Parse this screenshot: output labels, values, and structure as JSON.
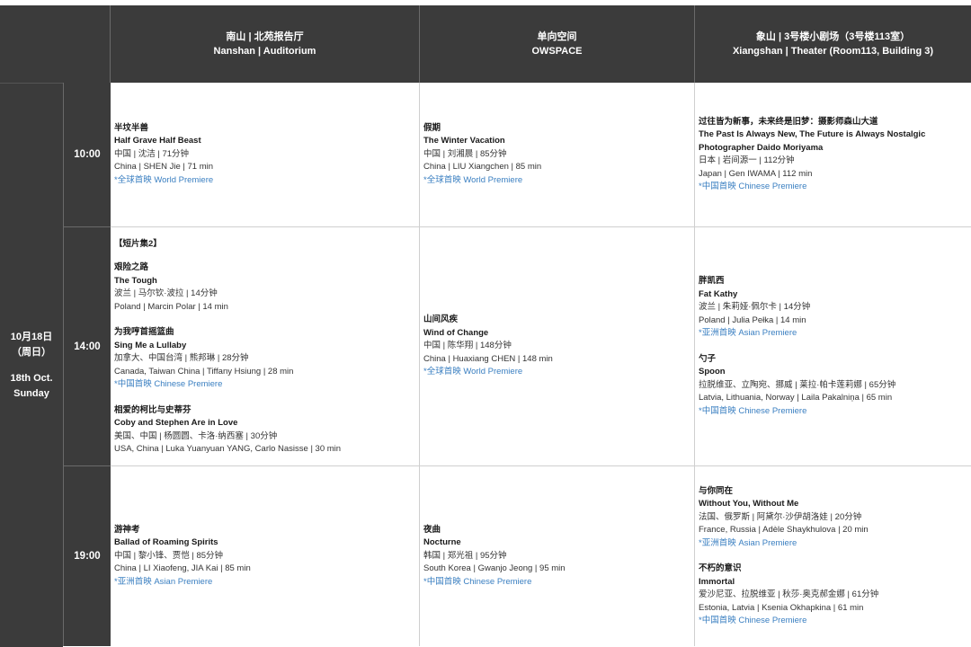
{
  "venues": [
    {
      "zh": "南山 | 北苑报告厅",
      "en": "Nanshan | Auditorium"
    },
    {
      "zh": "单向空间",
      "en": "OWSPACE"
    },
    {
      "zh": "象山 | 3号楼小剧场（3号楼113室）",
      "en": "Xiangshan | Theater (Room113, Building 3)"
    }
  ],
  "date": {
    "zh": "10月18日",
    "weekday_zh": "（周日）",
    "en": "18th Oct.",
    "weekday_en": "Sunday"
  },
  "slots": [
    {
      "time": "10:00",
      "cells": [
        {
          "films": [
            {
              "zh": "半坟半兽",
              "en": "Half Grave Half Beast",
              "meta_zh": "中国 | 沈洁 | 71分钟",
              "meta_en": "China | SHEN Jie | 71 min",
              "premiere": "*全球首映 World Premiere"
            }
          ]
        },
        {
          "films": [
            {
              "zh": "假期",
              "en": "The Winter Vacation",
              "meta_zh": "中国 | 刘湘晨 | 85分钟",
              "meta_en": "China | LIU Xiangchen | 85 min",
              "premiere": "*全球首映 World Premiere"
            }
          ]
        },
        {
          "films": [
            {
              "zh": "过往皆为新事，未来终是旧梦：摄影师森山大道",
              "en": "The Past Is Always New, The Future is Always Nostalgic Photographer Daido Moriyama",
              "meta_zh": "日本 | 岩间源一 | 112分钟",
              "meta_en": "Japan | Gen IWAMA | 112 min",
              "premiere": "*中国首映 Chinese Premiere"
            }
          ]
        }
      ]
    },
    {
      "time": "14:00",
      "cells": [
        {
          "group": "【短片集2】",
          "films": [
            {
              "zh": "艰险之路",
              "en": "The Tough",
              "meta_zh": "波兰 | 马尔钦·波拉 | 14分钟",
              "meta_en": "Poland | Marcin Polar | 14 min",
              "premiere": ""
            },
            {
              "zh": "为我哼首摇篮曲",
              "en": "Sing Me a Lullaby",
              "meta_zh": "加拿大、中国台湾 | 熊邦琳 | 28分钟",
              "meta_en": "Canada, Taiwan China | Tiffany Hsiung | 28 min",
              "premiere": "*中国首映 Chinese Premiere"
            },
            {
              "zh": "相爱的柯比与史蒂芬",
              "en": "Coby and Stephen Are in Love",
              "meta_zh": "美国、中国 | 杨圆圆、卡洛·纳西塞 | 30分钟",
              "meta_en": "USA, China | Luka Yuanyuan YANG, Carlo Nasisse | 30 min",
              "premiere": ""
            }
          ]
        },
        {
          "films": [
            {
              "zh": "山间风疾",
              "en": "Wind of Change",
              "meta_zh": "中国 | 陈华翔 | 148分钟",
              "meta_en": "China | Huaxiang CHEN | 148 min",
              "premiere": "*全球首映 World Premiere"
            }
          ]
        },
        {
          "films": [
            {
              "zh": "胖凯西",
              "en": "Fat Kathy",
              "meta_zh": "波兰 | 朱莉娅·佩尔卡 | 14分钟",
              "meta_en": "Poland | Julia Pełka | 14 min",
              "premiere": "*亚洲首映 Asian Premiere"
            },
            {
              "zh": "勺子",
              "en": "Spoon",
              "meta_zh": "拉脱维亚、立陶宛、挪威 | 莱拉·帕卡莲莉娜 | 65分钟",
              "meta_en": "Latvia, Lithuania, Norway | Laila Pakalniņa | 65 min",
              "premiere": "*中国首映 Chinese Premiere"
            }
          ]
        }
      ]
    },
    {
      "time": "19:00",
      "cells": [
        {
          "films": [
            {
              "zh": "游神考",
              "en": "Ballad of Roaming Spirits",
              "meta_zh": "中国 | 黎小锋、贾恺 | 85分钟",
              "meta_en": "China | LI Xiaofeng, JIA Kai | 85 min",
              "premiere": "*亚洲首映 Asian Premiere"
            }
          ]
        },
        {
          "films": [
            {
              "zh": "夜曲",
              "en": "Nocturne",
              "meta_zh": "韩国 | 郑光祖 | 95分钟",
              "meta_en": "South Korea | Gwanjo Jeong | 95 min",
              "premiere": "*中国首映 Chinese Premiere"
            }
          ]
        },
        {
          "films": [
            {
              "zh": "与你同在",
              "en": "Without You, Without Me",
              "meta_zh": "法国、俄罗斯 | 阿黛尔·沙伊胡洛娃 | 20分钟",
              "meta_en": "France, Russia | Adèle Shaykhulova | 20 min",
              "premiere": "*亚洲首映 Asian Premiere"
            },
            {
              "zh": "不朽的意识",
              "en": "Immortal",
              "meta_zh": "爱沙尼亚、拉脱维亚 | 秋莎·奥克郝金娜 | 61分钟",
              "meta_en": "Estonia, Latvia | Ksenia Okhapkina | 61 min",
              "premiere": "*中国首映 Chinese Premiere"
            }
          ]
        }
      ]
    }
  ]
}
